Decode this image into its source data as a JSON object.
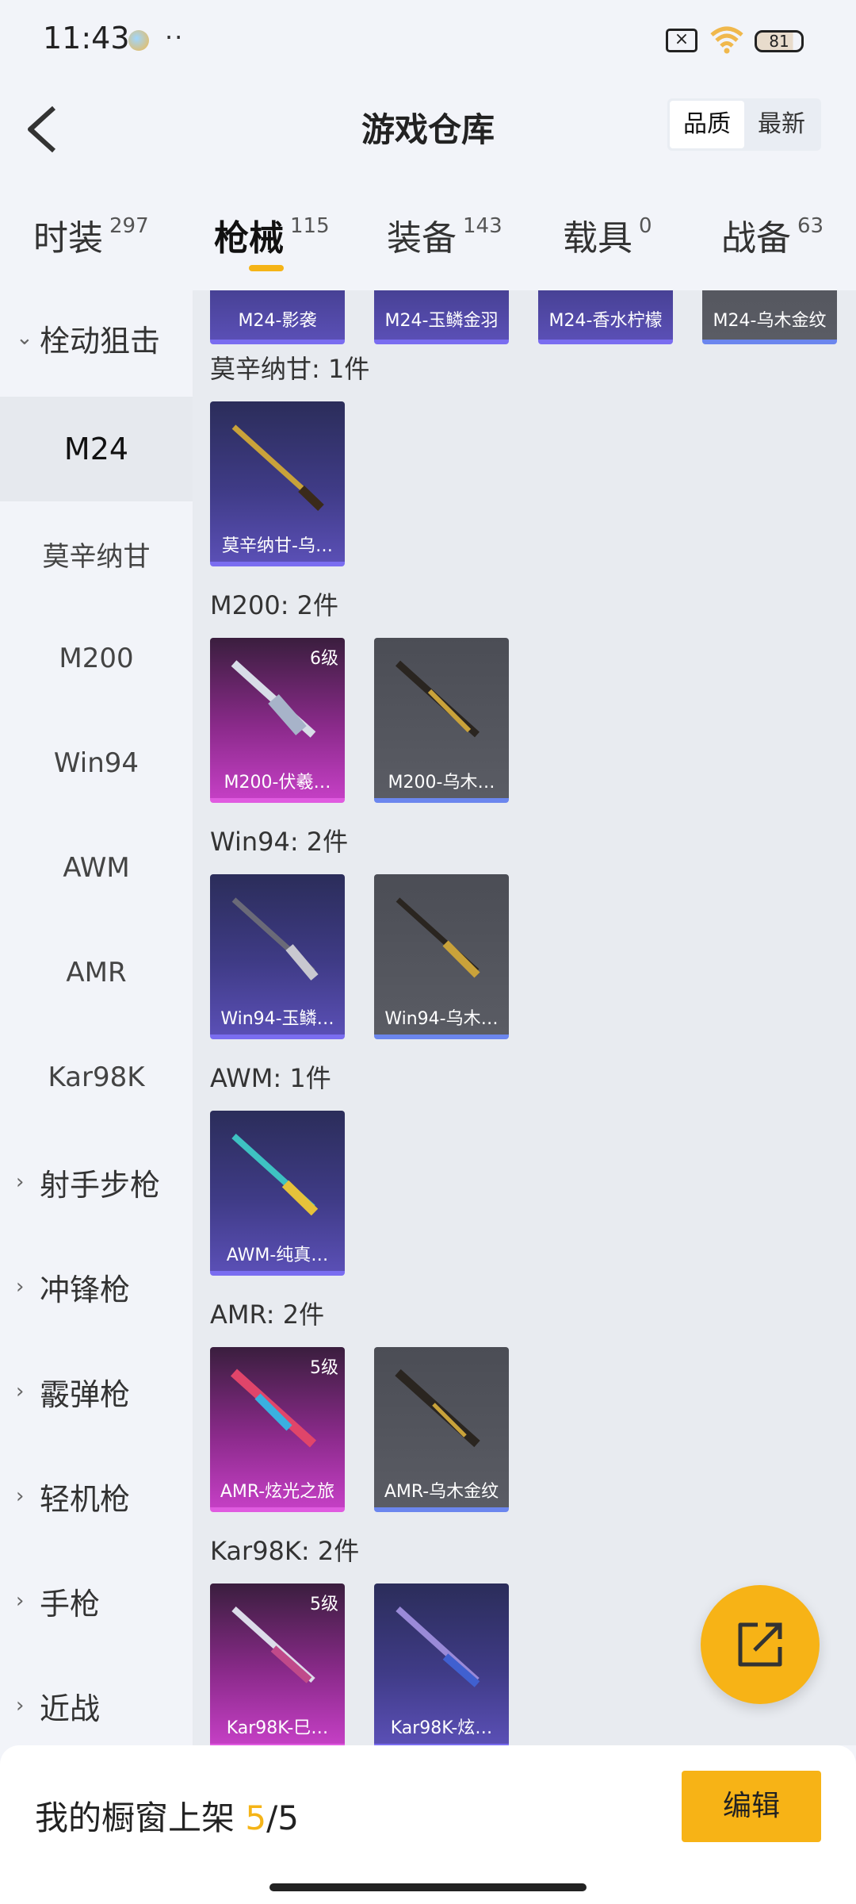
{
  "status": {
    "time": "11:43",
    "more": "··",
    "battery": "81"
  },
  "header": {
    "title": "游戏仓库",
    "sort": [
      "品质",
      "最新"
    ]
  },
  "tabs": [
    {
      "name": "时装",
      "count": "297"
    },
    {
      "name": "枪械",
      "count": "115"
    },
    {
      "name": "装备",
      "count": "143"
    },
    {
      "name": "载具",
      "count": "0"
    },
    {
      "name": "战备",
      "count": "63"
    }
  ],
  "sidebar": {
    "open_group": "栓动狙击",
    "items": [
      "M24",
      "莫辛纳甘",
      "M200",
      "Win94",
      "AWM",
      "AMR",
      "Kar98K"
    ],
    "groups": [
      "射手步枪",
      "冲锋枪",
      "霰弹枪",
      "轻机枪",
      "手枪",
      "近战"
    ]
  },
  "content": {
    "top_row": [
      "M24-影袭",
      "M24-玉鳞金羽",
      "M24-香水柠檬",
      "M24-乌木金纹"
    ],
    "sections": [
      {
        "label": "莫辛纳甘: 1件",
        "cards": [
          {
            "name": "莫辛纳甘-乌…",
            "level": ""
          }
        ]
      },
      {
        "label": "M200: 2件",
        "cards": [
          {
            "name": "M200-伏羲…",
            "level": "6级"
          },
          {
            "name": "M200-乌木…",
            "level": ""
          }
        ]
      },
      {
        "label": "Win94: 2件",
        "cards": [
          {
            "name": "Win94-玉鳞…",
            "level": ""
          },
          {
            "name": "Win94-乌木…",
            "level": ""
          }
        ]
      },
      {
        "label": "AWM: 1件",
        "cards": [
          {
            "name": "AWM-纯真…",
            "level": ""
          }
        ]
      },
      {
        "label": "AMR: 2件",
        "cards": [
          {
            "name": "AMR-炫光之旅",
            "level": "5级"
          },
          {
            "name": "AMR-乌木金纹",
            "level": ""
          }
        ]
      },
      {
        "label": "Kar98K: 2件",
        "cards": [
          {
            "name": "Kar98K-巳…",
            "level": "5级"
          },
          {
            "name": "Kar98K-炫…",
            "level": ""
          }
        ]
      }
    ]
  },
  "bottom": {
    "label": "我的橱窗上架 ",
    "current": "5",
    "total": "/5",
    "edit": "编辑"
  },
  "colors": {
    "accent": "#f7b316",
    "purple_card": "#4a44a0",
    "magenta_card": "#b23bb2",
    "grey_card": "#55575f"
  },
  "icons": {
    "back": "back-chevron-icon",
    "fab": "share-external-icon",
    "wifi": "wifi-icon",
    "battery": "battery-icon",
    "sim": "no-sim-icon"
  }
}
